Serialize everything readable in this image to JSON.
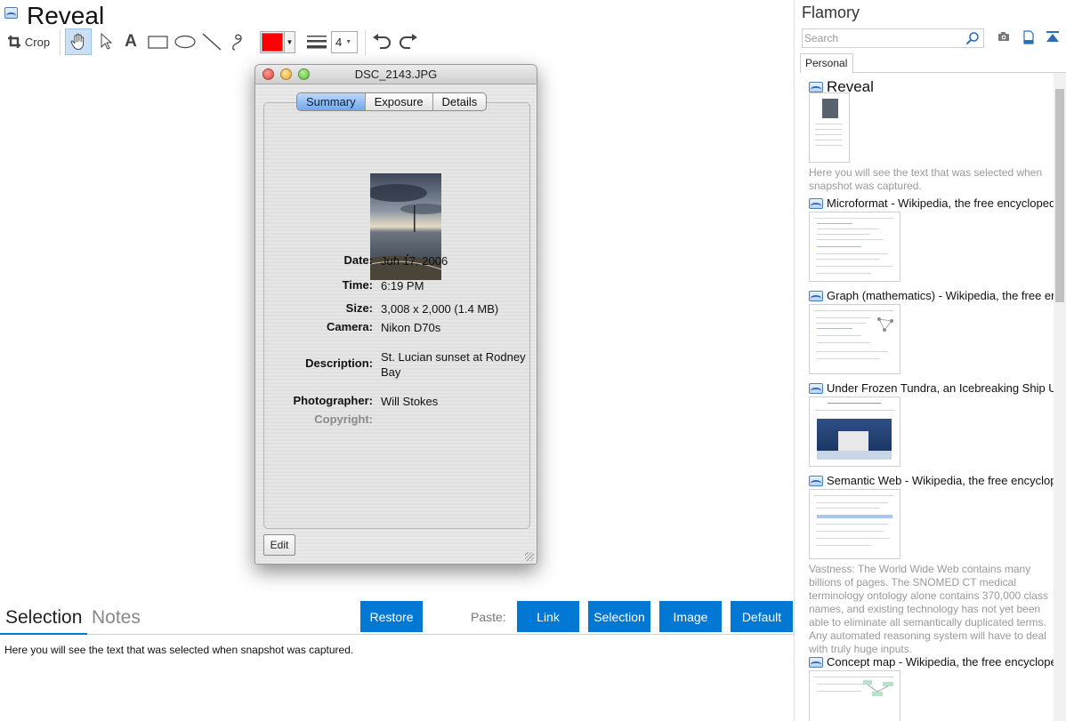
{
  "app": {
    "title": "Reveal"
  },
  "toolbar": {
    "crop_label": "Crop",
    "text_tool_label": "A",
    "color_value": "#ff0000",
    "line_width_value": "4"
  },
  "photo_window": {
    "title": "DSC_2143.JPG",
    "tabs": [
      "Summary",
      "Exposure",
      "Details"
    ],
    "active_tab": "Summary",
    "fields": [
      {
        "label": "Date:",
        "value": "Jun 17, 2006"
      },
      {
        "label": "Time:",
        "value": "6:19 PM"
      },
      {
        "label": "Size:",
        "value": "3,008 x 2,000 (1.4 MB)"
      },
      {
        "label": "Camera:",
        "value": "Nikon D70s"
      },
      {
        "label": "Description:",
        "value": "St. Lucian sunset at Rodney Bay"
      },
      {
        "label": "Photographer:",
        "value": "Will Stokes"
      },
      {
        "label": "Copyright:",
        "value": ""
      }
    ],
    "edit_label": "Edit"
  },
  "bottom": {
    "tabs": [
      "Selection",
      "Notes"
    ],
    "active_tab": "Selection",
    "restore_label": "Restore",
    "paste_label": "Paste:",
    "paste_buttons": [
      "Link",
      "Selection",
      "Image",
      "Default"
    ],
    "selection_text": "Here you will see the text that was selected when snapshot was captured."
  },
  "sidebar": {
    "title": "Flamory",
    "search_placeholder": "Search",
    "tabs": [
      "Personal"
    ],
    "items": [
      {
        "title": "Reveal",
        "description": "Here you will see the text that was selected when snapshot was captured."
      },
      {
        "title": "Microformat - Wikipedia, the free encyclopedia",
        "description": ""
      },
      {
        "title": "Graph (mathematics) - Wikipedia, the free ency",
        "description": ""
      },
      {
        "title": "Under Frozen Tundra, an Icebreaking Ship Unco",
        "description": ""
      },
      {
        "title": "Semantic Web - Wikipedia, the free encycloped",
        "description": "Vastness: The World Wide Web contains many billions of pages. The SNOMED CT medical terminology ontology alone contains 370,000 class names, and existing technology has not yet been able to eliminate all semantically duplicated terms. Any automated reasoning system will have to deal with truly huge inputs."
      },
      {
        "title": "Concept map - Wikipedia, the free encyclopedi",
        "description": ""
      }
    ]
  },
  "colors": {
    "accent": "#0078d4",
    "active_tab_underline": "#0078d7",
    "selected_tool_bg": "#cce0f5"
  }
}
